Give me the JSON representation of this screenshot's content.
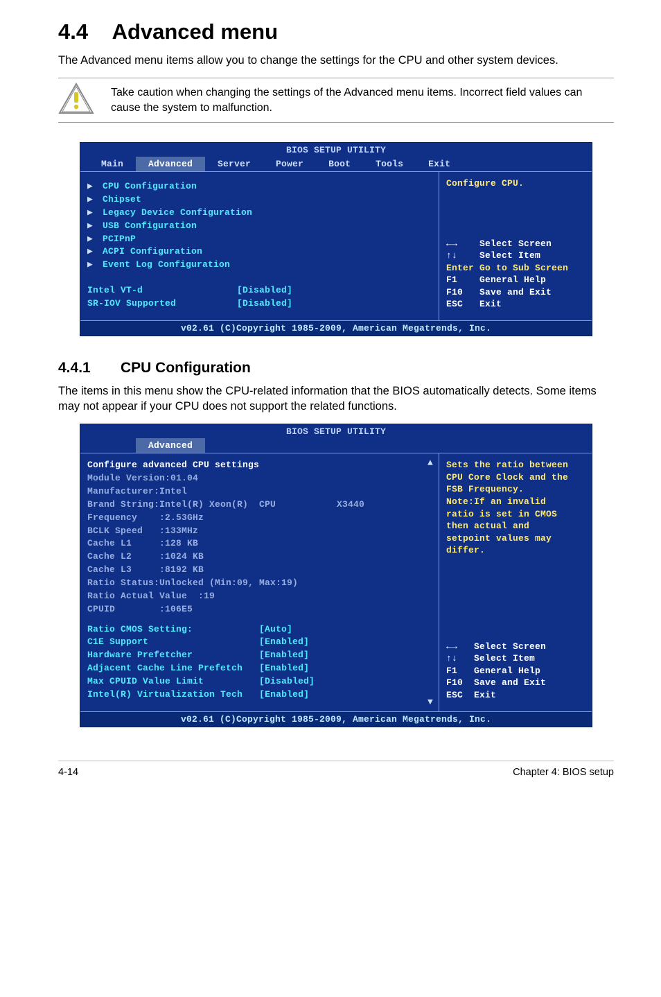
{
  "section": {
    "number": "4.4",
    "title": "Advanced menu"
  },
  "intro": "The Advanced menu items allow you to change the settings for the CPU and other system devices.",
  "caution": "Take caution when changing the settings of the Advanced menu items. Incorrect field values can cause the system to malfunction.",
  "bios_common": {
    "title": "BIOS SETUP UTILITY",
    "tabs": [
      "Main",
      "Advanced",
      "Server",
      "Power",
      "Boot",
      "Tools",
      "Exit"
    ],
    "footer": "v02.61 (C)Copyright 1985-2009, American Megatrends, Inc.",
    "help_keys": {
      "l1": "←→    Select Screen",
      "l2": "↑↓    Select Item",
      "l3": "Enter Go to Sub Screen",
      "l4": "F1    General Help",
      "l5": "F10   Save and Exit",
      "l6": "ESC   Exit"
    },
    "help_keys_short": {
      "l1": "←→   Select Screen",
      "l2": "↑↓   Select Item",
      "l3": "F1   General Help",
      "l4": "F10  Save and Exit",
      "l5": "ESC  Exit"
    }
  },
  "bios1": {
    "menu": [
      "CPU Configuration",
      "Chipset",
      "Legacy Device Configuration",
      "USB Configuration",
      "PCIPnP",
      "ACPI Configuration",
      "Event Log Configuration"
    ],
    "settings": [
      {
        "name": "Intel VT-d",
        "val": "[Disabled]"
      },
      {
        "name": "SR-IOV Supported",
        "val": "[Disabled]"
      }
    ],
    "help_top": "Configure CPU."
  },
  "subsection": {
    "number": "4.4.1",
    "title": "CPU Configuration"
  },
  "sub_intro": "The items in this menu show the CPU-related information that the BIOS automatically detects. Some items may not appear if your CPU does not support the related functions.",
  "bios2": {
    "header1": "Configure advanced CPU settings",
    "header2": "Module Version:01.04",
    "info": [
      "Manufacturer:Intel",
      "Brand String:Intel(R) Xeon(R)  CPU           X3440",
      "Frequency    :2.53GHz",
      "BCLK Speed   :133MHz",
      "Cache L1     :128 KB",
      "Cache L2     :1024 KB",
      "Cache L3     :8192 KB",
      "Ratio Status:Unlocked (Min:09, Max:19)",
      "Ratio Actual Value  :19",
      "CPUID        :106E5"
    ],
    "settings": [
      {
        "name": "Ratio CMOS Setting:",
        "val": "[Auto]"
      },
      {
        "name": "C1E Support",
        "val": "[Enabled]"
      },
      {
        "name": "Hardware Prefetcher",
        "val": "[Enabled]"
      },
      {
        "name": "Adjacent Cache Line Prefetch",
        "val": "[Enabled]"
      },
      {
        "name": "Max CPUID Value Limit",
        "val": "[Disabled]"
      },
      {
        "name": "Intel(R) Virtualization Tech",
        "val": "[Enabled]"
      }
    ],
    "help_lines": [
      "Sets the ratio between",
      "CPU Core Clock and the",
      "FSB Frequency.",
      "Note:If an invalid",
      "ratio is set in CMOS",
      "then actual and",
      "setpoint values may",
      "differ."
    ]
  },
  "footer": {
    "left": "4-14",
    "right": "Chapter 4: BIOS setup"
  }
}
